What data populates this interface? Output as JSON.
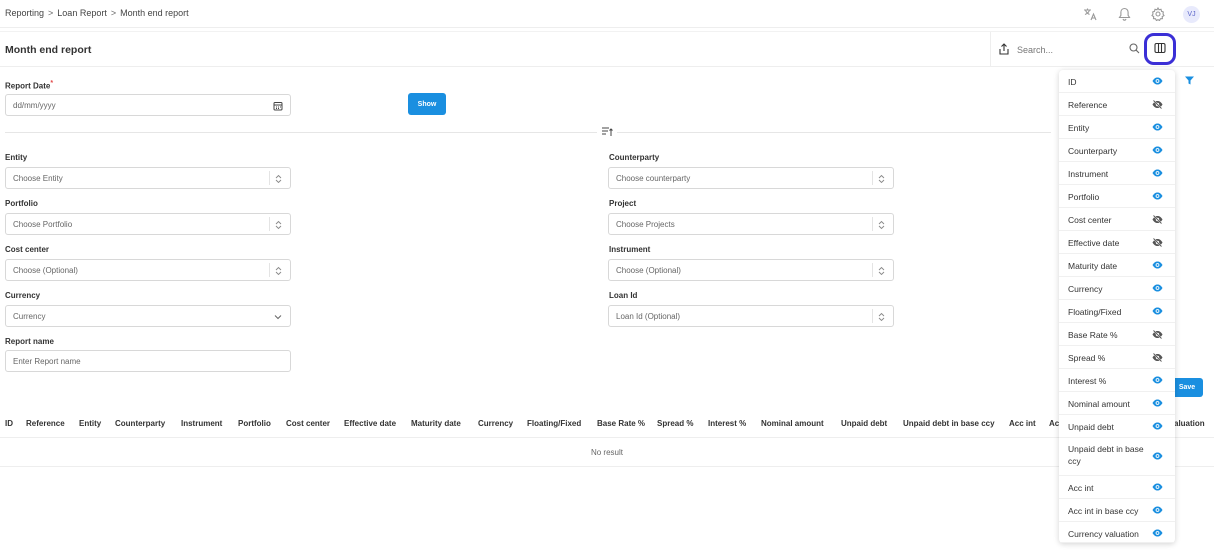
{
  "breadcrumb": [
    "Reporting",
    "Loan Report",
    "Month end report"
  ],
  "breadcrumb_sep": ">",
  "user": {
    "initials": "VJ"
  },
  "header": {
    "title": "Month end report",
    "search_placeholder": "Search..."
  },
  "form": {
    "report_date": {
      "label": "Report Date",
      "required": "*",
      "placeholder": "dd/mm/yyyy"
    },
    "show_label": "Show",
    "entity": {
      "label": "Entity",
      "placeholder": "Choose Entity"
    },
    "counterparty": {
      "label": "Counterparty",
      "placeholder": "Choose counterparty"
    },
    "portfolio": {
      "label": "Portfolio",
      "placeholder": "Choose Portfolio"
    },
    "project": {
      "label": "Project",
      "placeholder": "Choose Projects"
    },
    "cost_center": {
      "label": "Cost center",
      "placeholder": "Choose (Optional)"
    },
    "instrument": {
      "label": "Instrument",
      "placeholder": "Choose (Optional)"
    },
    "currency": {
      "label": "Currency",
      "placeholder": "Currency"
    },
    "loan_id": {
      "label": "Loan Id",
      "placeholder": "Loan Id (Optional)"
    },
    "report_name": {
      "label": "Report name",
      "placeholder": "Enter Report name"
    },
    "save_label": "Save"
  },
  "table": {
    "headers": [
      "ID",
      "Reference",
      "Entity",
      "Counterparty",
      "Instrument",
      "Portfolio",
      "Cost center",
      "Effective date",
      "Maturity date",
      "Currency",
      "Floating/Fixed",
      "Base Rate %",
      "Spread %",
      "Interest %",
      "Nominal amount",
      "Unpaid debt",
      "Unpaid debt in base ccy",
      "Acc int",
      "Ac",
      "aluation"
    ],
    "empty_text": "No result"
  },
  "column_panel": {
    "items": [
      {
        "label": "ID",
        "visible": true
      },
      {
        "label": "Reference",
        "visible": false
      },
      {
        "label": "Entity",
        "visible": true
      },
      {
        "label": "Counterparty",
        "visible": true
      },
      {
        "label": "Instrument",
        "visible": true
      },
      {
        "label": "Portfolio",
        "visible": true
      },
      {
        "label": "Cost center",
        "visible": false
      },
      {
        "label": "Effective date",
        "visible": false
      },
      {
        "label": "Maturity date",
        "visible": true
      },
      {
        "label": "Currency",
        "visible": true
      },
      {
        "label": "Floating/Fixed",
        "visible": true
      },
      {
        "label": "Base Rate %",
        "visible": false
      },
      {
        "label": "Spread %",
        "visible": false
      },
      {
        "label": "Interest %",
        "visible": true
      },
      {
        "label": "Nominal amount",
        "visible": true
      },
      {
        "label": "Unpaid debt",
        "visible": true
      },
      {
        "label": "Unpaid debt in base ccy",
        "visible": true
      },
      {
        "label": "Acc int",
        "visible": true
      },
      {
        "label": "Acc int in base ccy",
        "visible": true
      },
      {
        "label": "Currency valuation",
        "visible": true
      }
    ]
  },
  "colors": {
    "accent": "#1a8fe0",
    "highlight": "#3b2fd6",
    "required": "#e24a4a"
  }
}
